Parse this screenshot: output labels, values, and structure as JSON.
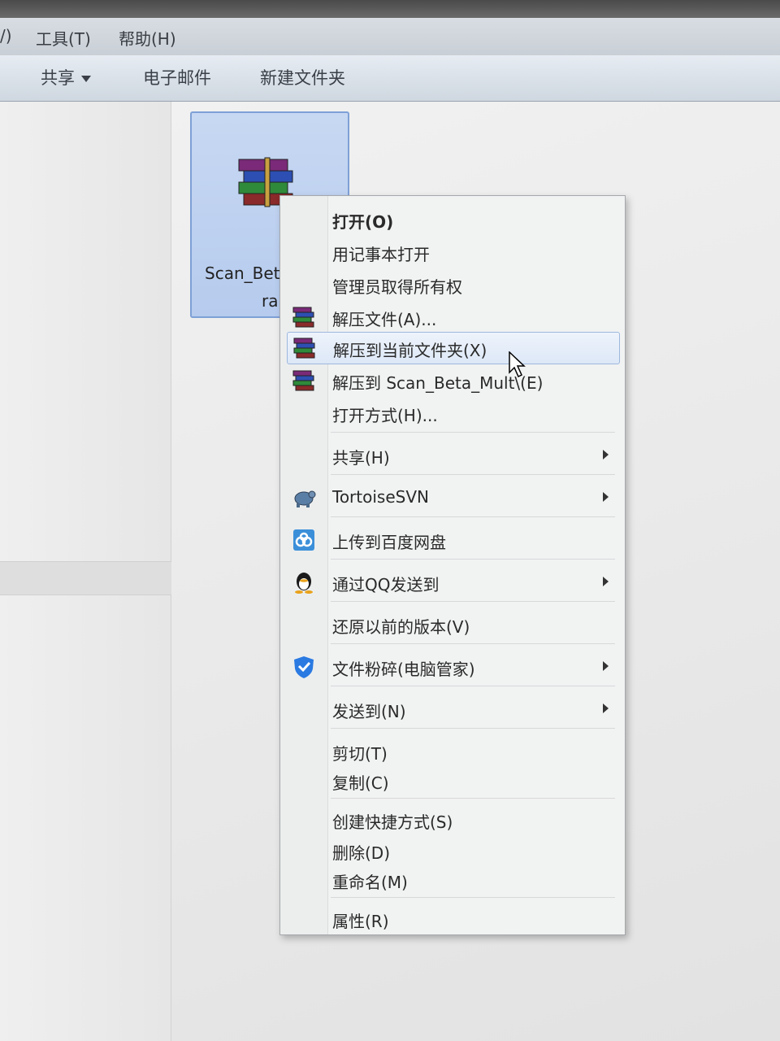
{
  "menubar": {
    "left_fragment": "/)",
    "tools": "工具(T)",
    "help": "帮助(H)"
  },
  "toolbar": {
    "share": "共享",
    "email": "电子邮件",
    "new_folder": "新建文件夹"
  },
  "file": {
    "name_line1": "Scan_Bet",
    "name_line2": "ra",
    "icon": "winrar-archive-icon"
  },
  "context_menu": {
    "items": [
      {
        "label": "打开(O)"
      },
      {
        "label": "用记事本打开"
      },
      {
        "label": "管理员取得所有权"
      },
      {
        "label": "解压文件(A)...",
        "icon": "winrar-icon"
      },
      {
        "label": "解压到当前文件夹(X)",
        "icon": "winrar-icon"
      },
      {
        "label": "解压到 Scan_Beta_Mult\\(E)",
        "icon": "winrar-icon"
      },
      {
        "label": "打开方式(H)..."
      },
      {
        "label": "共享(H)"
      },
      {
        "label": "TortoiseSVN",
        "icon": "tortoisesvn-icon"
      },
      {
        "label": "上传到百度网盘",
        "icon": "baidu-netdisk-icon"
      },
      {
        "label": "通过QQ发送到",
        "icon": "qq-penguin-icon"
      },
      {
        "label": "还原以前的版本(V)"
      },
      {
        "label": "文件粉碎(电脑管家)",
        "icon": "tencent-pc-manager-shield-icon"
      },
      {
        "label": "发送到(N)"
      },
      {
        "label": "剪切(T)"
      },
      {
        "label": "复制(C)"
      },
      {
        "label": "创建快捷方式(S)"
      },
      {
        "label": "删除(D)"
      },
      {
        "label": "重命名(M)"
      },
      {
        "label": "属性(R)"
      }
    ],
    "highlighted": "解压到当前文件夹(X)"
  },
  "colors": {
    "selection": "#b6cbee",
    "menu_bg": "#f1f2f2",
    "hover": "#dde8f7"
  }
}
